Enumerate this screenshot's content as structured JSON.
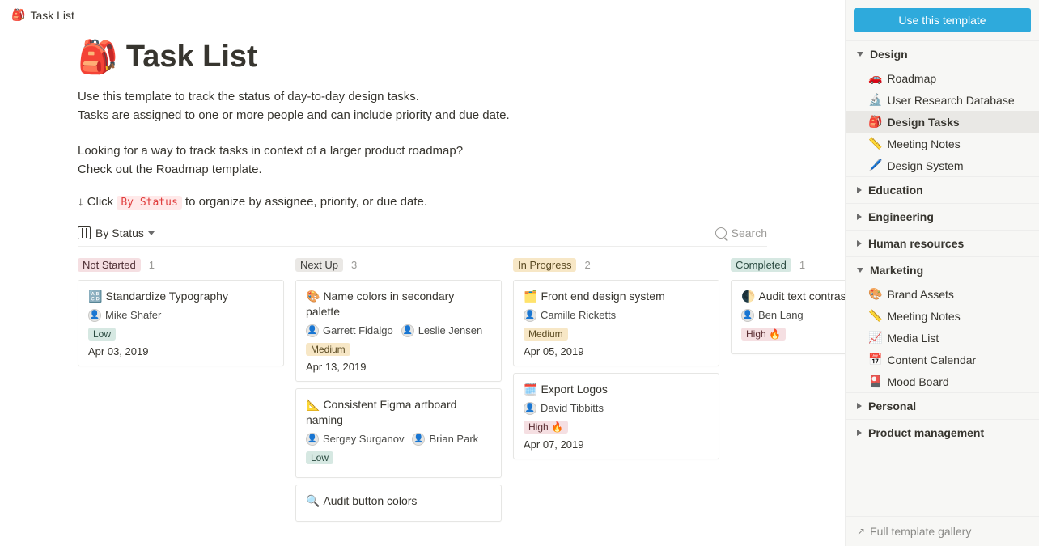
{
  "breadcrumb": {
    "icon": "🎒",
    "title": "Task List"
  },
  "page": {
    "icon": "🎒",
    "title": "Task List",
    "desc1a": "Use this template to track the status of day-to-day design tasks.",
    "desc1b": "Tasks are assigned to one or more people and can include priority and due date.",
    "desc2a": "Looking for a way to track tasks in context of a larger product roadmap?",
    "desc2b": "Check out the Roadmap template.",
    "hint_prefix": "↓ Click",
    "hint_code": "By Status",
    "hint_suffix": "to organize by assignee, priority, or due date."
  },
  "view": {
    "name": "By Status",
    "search_placeholder": "Search"
  },
  "columns": [
    {
      "id": "notstarted",
      "label": "Not Started",
      "count": "1",
      "cls": "tag-notstarted"
    },
    {
      "id": "nextup",
      "label": "Next Up",
      "count": "3",
      "cls": "tag-nextup"
    },
    {
      "id": "inprogress",
      "label": "In Progress",
      "count": "2",
      "cls": "tag-inprogress"
    },
    {
      "id": "completed",
      "label": "Completed",
      "count": "1",
      "cls": "tag-completed"
    }
  ],
  "cards": {
    "notstarted": [
      {
        "icon": "🔠",
        "title": "Standardize Typography",
        "people": [
          "Mike Shafer"
        ],
        "priority": "Low",
        "prio_cls": "prio-low",
        "due": "Apr 03, 2019"
      }
    ],
    "nextup": [
      {
        "icon": "🎨",
        "title": "Name colors in secondary palette",
        "people": [
          "Garrett Fidalgo",
          "Leslie Jensen"
        ],
        "priority": "Medium",
        "prio_cls": "prio-medium",
        "due": "Apr 13, 2019"
      },
      {
        "icon": "📐",
        "title": "Consistent Figma artboard naming",
        "people": [
          "Sergey Surganov",
          "Brian Park"
        ],
        "priority": "Low",
        "prio_cls": "prio-low",
        "due": ""
      },
      {
        "icon": "🔍",
        "title": "Audit button colors",
        "people": [],
        "priority": "",
        "prio_cls": "",
        "due": ""
      }
    ],
    "inprogress": [
      {
        "icon": "🗂️",
        "title": "Front end design system",
        "people": [
          "Camille Ricketts"
        ],
        "priority": "Medium",
        "prio_cls": "prio-medium",
        "due": "Apr 05, 2019"
      },
      {
        "icon": "🗓️",
        "title": "Export Logos",
        "people": [
          "David Tibbitts"
        ],
        "priority": "High 🔥",
        "prio_cls": "prio-high",
        "due": "Apr 07, 2019"
      }
    ],
    "completed": [
      {
        "icon": "🌓",
        "title": "Audit text contrast accessibility",
        "people": [
          "Ben Lang"
        ],
        "priority": "High 🔥",
        "prio_cls": "prio-high",
        "due": ""
      }
    ]
  },
  "sidebar": {
    "cta": "Use this template",
    "footer": "Full template gallery",
    "sections": [
      {
        "label": "Design",
        "open": true,
        "items": [
          {
            "icon": "🚗",
            "label": "Roadmap"
          },
          {
            "icon": "🔬",
            "label": "User Research Database"
          },
          {
            "icon": "🎒",
            "label": "Design Tasks",
            "active": true
          },
          {
            "icon": "📏",
            "label": "Meeting Notes"
          },
          {
            "icon": "🖊️",
            "label": "Design System"
          }
        ]
      },
      {
        "label": "Education",
        "open": false,
        "items": []
      },
      {
        "label": "Engineering",
        "open": false,
        "items": []
      },
      {
        "label": "Human resources",
        "open": false,
        "items": []
      },
      {
        "label": "Marketing",
        "open": true,
        "items": [
          {
            "icon": "🎨",
            "label": "Brand Assets"
          },
          {
            "icon": "📏",
            "label": "Meeting Notes"
          },
          {
            "icon": "📈",
            "label": "Media List"
          },
          {
            "icon": "📅",
            "label": "Content Calendar"
          },
          {
            "icon": "🎴",
            "label": "Mood Board"
          }
        ]
      },
      {
        "label": "Personal",
        "open": false,
        "items": []
      },
      {
        "label": "Product management",
        "open": false,
        "items": []
      }
    ]
  }
}
